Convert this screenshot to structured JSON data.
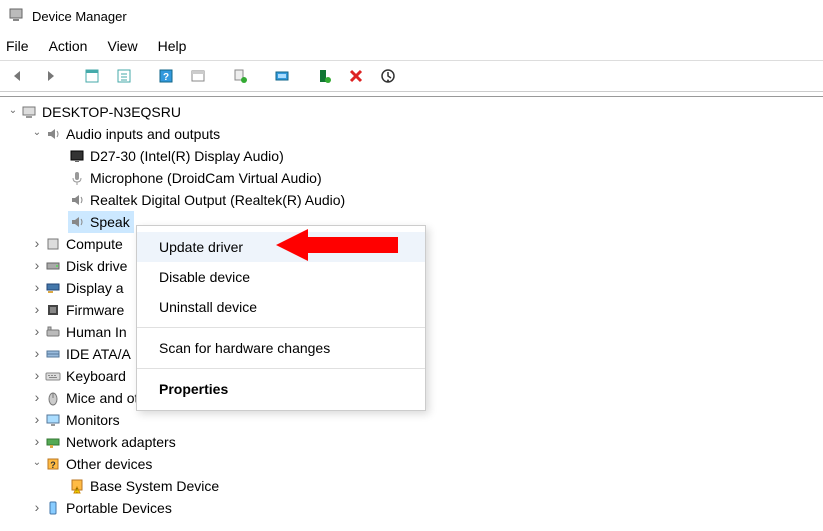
{
  "window": {
    "title": "Device Manager"
  },
  "menubar": {
    "items": [
      "File",
      "Action",
      "View",
      "Help"
    ]
  },
  "tree": {
    "root": {
      "label": "DESKTOP-N3EQSRU",
      "expanded": true
    },
    "audio": {
      "label": "Audio inputs and outputs",
      "expanded": true,
      "children": [
        "D27-30 (Intel(R) Display Audio)",
        "Microphone (DroidCam Virtual Audio)",
        "Realtek Digital Output (Realtek(R) Audio)",
        "Speak"
      ]
    },
    "categories": [
      {
        "label": "Compute",
        "expanded": false
      },
      {
        "label": "Disk drive",
        "expanded": false
      },
      {
        "label": "Display a",
        "expanded": false
      },
      {
        "label": "Firmware",
        "expanded": false
      },
      {
        "label": "Human In",
        "expanded": false
      },
      {
        "label": "IDE ATA/A",
        "expanded": false
      },
      {
        "label": "Keyboard",
        "expanded": false
      },
      {
        "label": "Mice and other pointing devices",
        "expanded": false
      },
      {
        "label": "Monitors",
        "expanded": false
      },
      {
        "label": "Network adapters",
        "expanded": false
      }
    ],
    "other": {
      "label": "Other devices",
      "expanded": true,
      "children": [
        "Base System Device"
      ]
    },
    "portable": {
      "label": "Portable Devices",
      "expanded": false
    }
  },
  "context_menu": {
    "items": [
      {
        "label": "Update driver",
        "hover": true
      },
      {
        "label": "Disable device"
      },
      {
        "label": "Uninstall device"
      },
      {
        "sep": true
      },
      {
        "label": "Scan for hardware changes"
      },
      {
        "sep": true
      },
      {
        "label": "Properties",
        "bold": true
      }
    ]
  }
}
